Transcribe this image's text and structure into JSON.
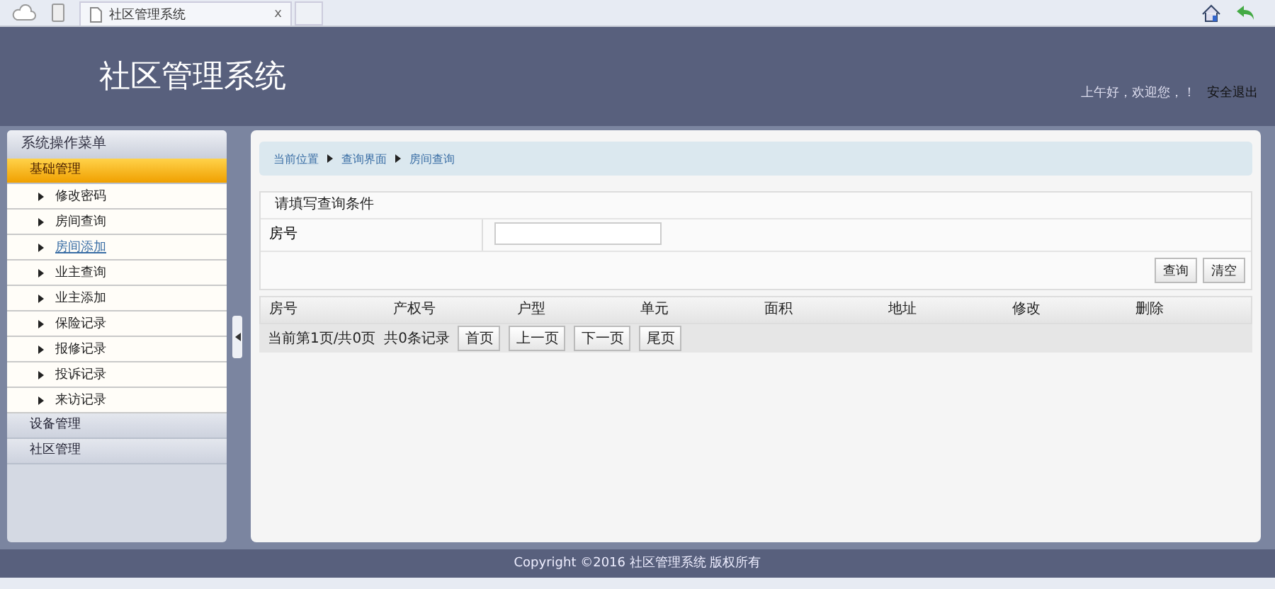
{
  "browser": {
    "tab_title": "社区管理系统",
    "close": "x"
  },
  "header": {
    "title": "社区管理系统",
    "greeting": "上午好，欢迎您，！",
    "logout": "安全退出"
  },
  "sidebar": {
    "title": "系统操作菜单",
    "groups": [
      {
        "label": "基础管理",
        "expanded": true,
        "children": [
          {
            "label": "修改密码",
            "hovered": false
          },
          {
            "label": "房间查询",
            "hovered": false
          },
          {
            "label": "房间添加",
            "hovered": true
          },
          {
            "label": "业主查询",
            "hovered": false
          },
          {
            "label": "业主添加",
            "hovered": false
          },
          {
            "label": "保险记录",
            "hovered": false
          },
          {
            "label": "报修记录",
            "hovered": false
          },
          {
            "label": "投诉记录",
            "hovered": false
          },
          {
            "label": "来访记录",
            "hovered": false
          }
        ]
      },
      {
        "label": "设备管理",
        "expanded": false
      },
      {
        "label": "社区管理",
        "expanded": false
      }
    ]
  },
  "breadcrumb": [
    "当前位置",
    "查询界面",
    "房间查询"
  ],
  "query": {
    "title": "请填写查询条件",
    "field_label": "房号",
    "buttons": [
      "查询",
      "清空"
    ]
  },
  "table": {
    "columns": [
      "房号",
      "产权号",
      "户型",
      "单元",
      "面积",
      "地址",
      "修改",
      "删除"
    ]
  },
  "pager": {
    "info": "当前第1页/共0页",
    "count": "共0条记录",
    "buttons": [
      "首页",
      "上一页",
      "下一页",
      "尾页"
    ]
  },
  "footer": "Copyright ©2016 社区管理系统 版权所有"
}
